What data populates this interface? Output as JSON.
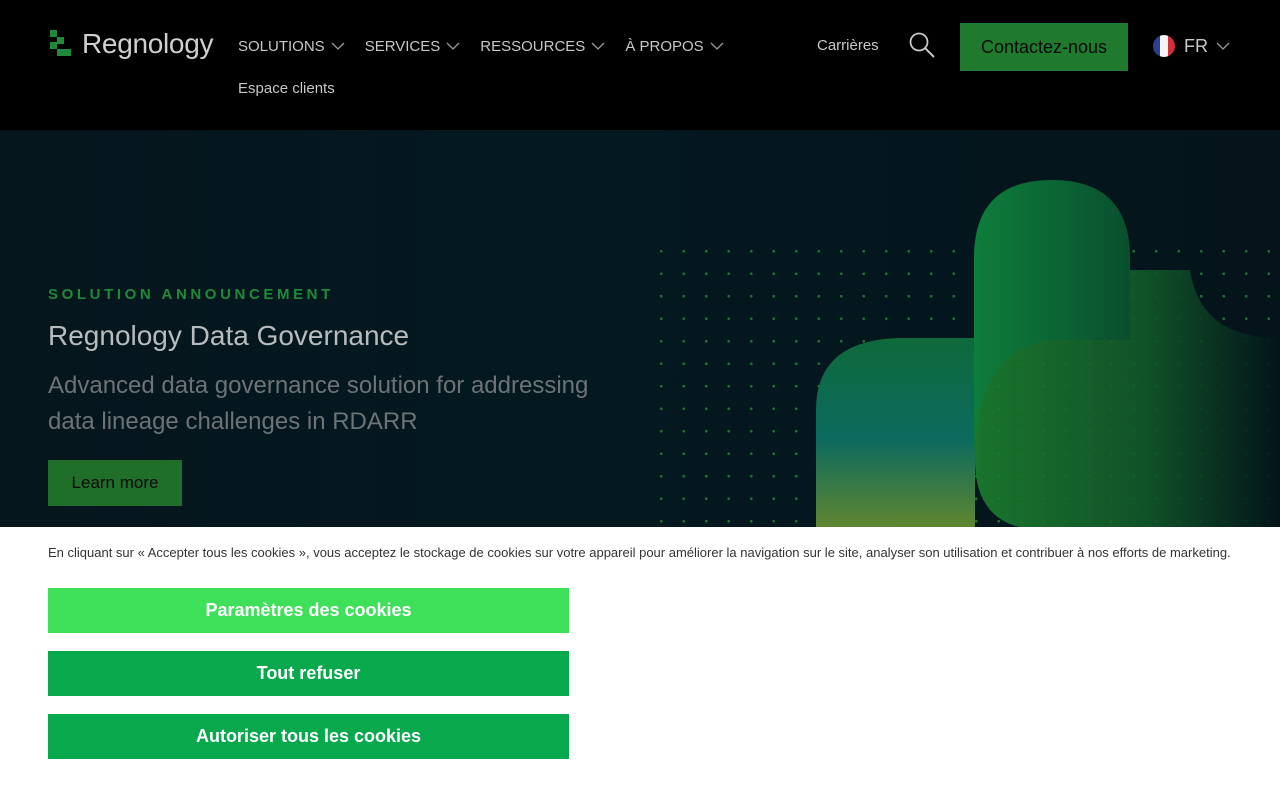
{
  "brand": {
    "name": "Regnology",
    "color": "#1f8a3a"
  },
  "header": {
    "nav": [
      {
        "label": "SOLUTIONS",
        "icon": "chevron-down-icon"
      },
      {
        "label": "SERVICES",
        "icon": "chevron-down-icon"
      },
      {
        "label": "RESSOURCES",
        "icon": "chevron-down-icon"
      },
      {
        "label": "À PROPOS",
        "icon": "chevron-down-icon"
      }
    ],
    "espace_clients": "Espace clients",
    "carrieres": "Carrières",
    "search_icon": "search-icon",
    "contact_label": "Contactez-nous",
    "lang": {
      "label": "FR",
      "flag": "france-flag-icon",
      "icon": "chevron-down-icon"
    }
  },
  "hero": {
    "eyebrow": "SOLUTION ANNOUNCEMENT",
    "title": "Regnology Data Governance",
    "subtitle": "Advanced data governance solution for addressing data lineage challenges in RDARR",
    "cta_label": "Learn more"
  },
  "cookie": {
    "text": "En cliquant sur « Accepter tous les cookies », vous acceptez le stockage de cookies sur votre appareil pour améliorer la navigation sur le site, analyser son utilisation et contribuer à nos efforts de marketing.",
    "settings_label": "Paramètres des cookies",
    "refuse_label": "Tout refuser",
    "accept_label": "Autoriser tous les cookies"
  },
  "colors": {
    "header_bg": "#000000",
    "hero_bg": "#05171e",
    "cta_green": "#1f7a2e",
    "cookie_light_green": "#3ee05a",
    "cookie_green": "#08a84d"
  }
}
